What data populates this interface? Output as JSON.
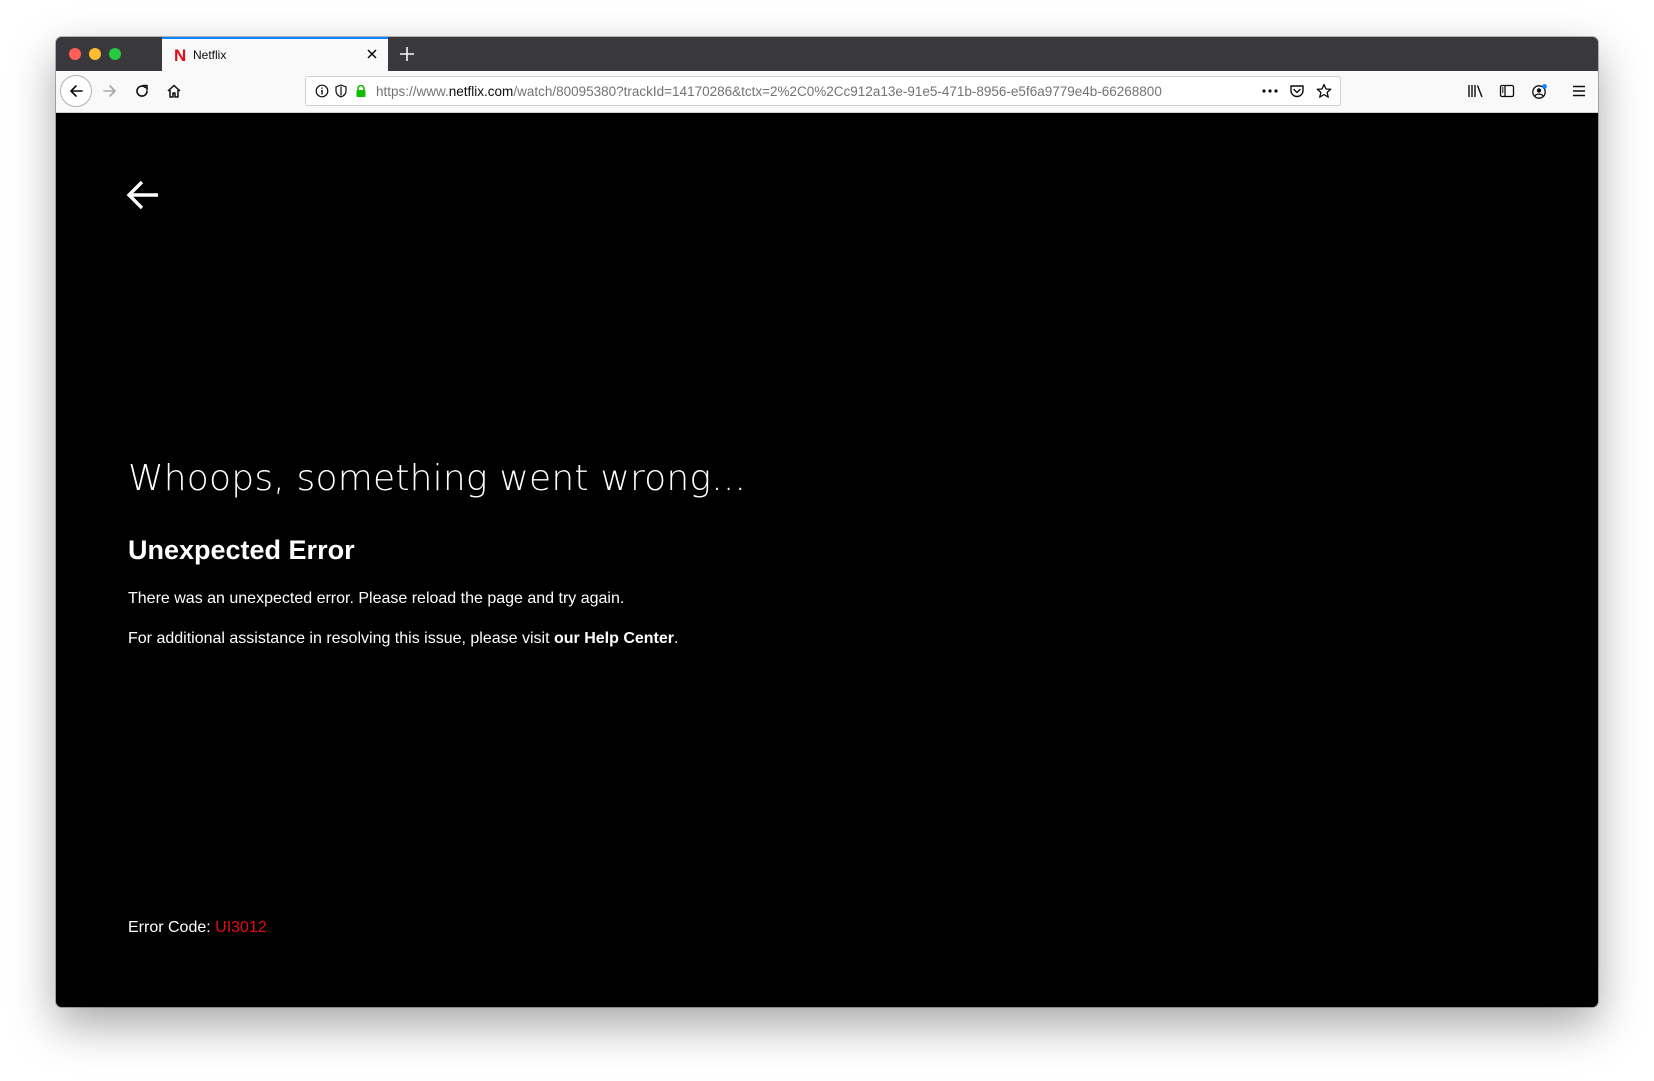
{
  "browser": {
    "tab": {
      "title": "Netflix",
      "favicon": "netflix-n-icon",
      "favicon_letter": "N"
    },
    "url": {
      "scheme": "https://www.",
      "host": "netflix.com",
      "path": "/watch/80095380?trackId=14170286&tctx=2%2C0%2Cc912a13e-91e5-471b-8956-e5f6a9779e4b-66268800"
    },
    "toolbar_icons": [
      "back-icon",
      "forward-icon",
      "reload-icon",
      "home-icon",
      "info-icon",
      "tracking-shield-icon",
      "lock-icon",
      "more-actions-icon",
      "pocket-icon",
      "bookmark-star-icon",
      "library-icon",
      "sidebar-icon",
      "account-icon",
      "menu-icon"
    ]
  },
  "page": {
    "headline": "Whoops, something went wrong...",
    "error_title": "Unexpected Error",
    "error_message": "There was an unexpected error. Please reload the page and try again.",
    "help_prefix": "For additional assistance in resolving this issue, please visit ",
    "help_link": "our Help Center",
    "help_suffix": ".",
    "error_code_label": "Error Code: ",
    "error_code": "UI3012"
  },
  "colors": {
    "netflix_red": "#e50914",
    "background": "#000000",
    "text": "#ffffff",
    "tab_accent": "#0a84ff",
    "lock_green": "#12bc00"
  }
}
